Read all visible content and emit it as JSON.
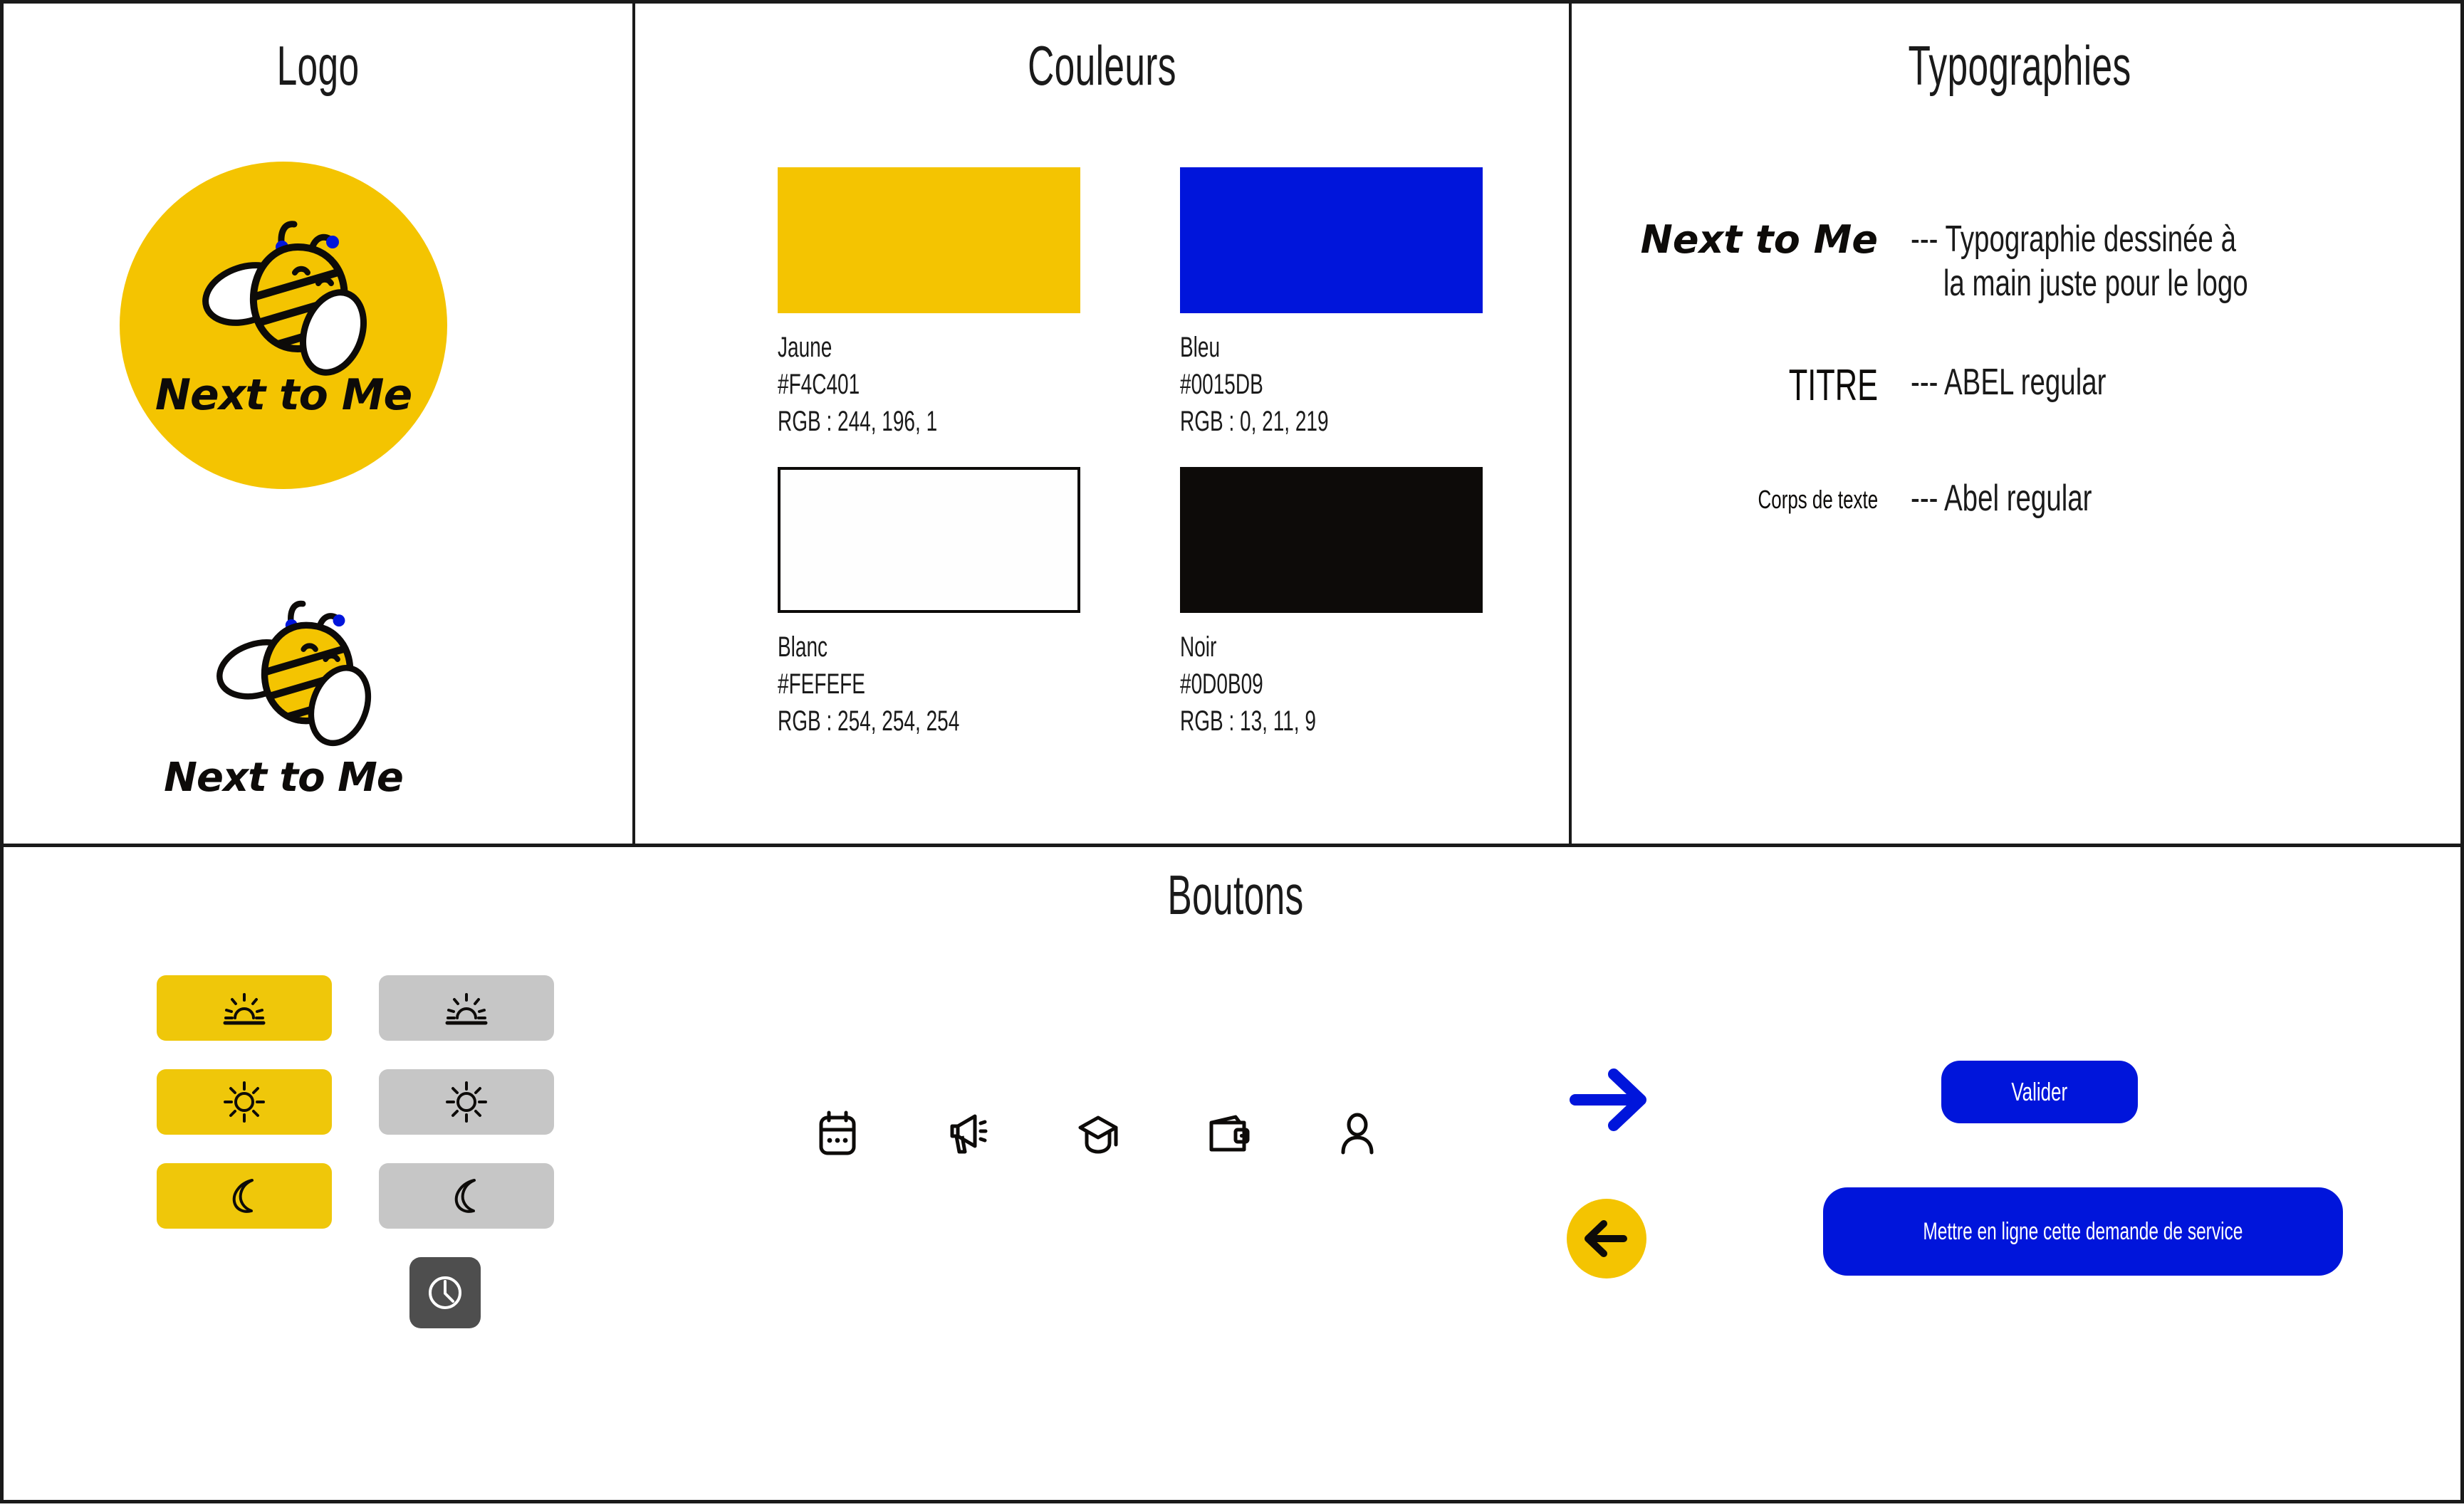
{
  "sections": {
    "logo": "Logo",
    "couleurs": "Couleurs",
    "typographies": "Typographies",
    "boutons": "Boutons"
  },
  "logo": {
    "wordmark": "Next to Me",
    "circle_color": "#F4C401",
    "bee_body_color": "#F4C401",
    "antenna_dot_color": "#0015DB",
    "outline_color": "#0d0b09"
  },
  "colors": [
    {
      "name": "Jaune",
      "hex": "#F4C401",
      "rgb": "RGB : 244, 196, 1",
      "swatch": "#F4C401",
      "bordered": false
    },
    {
      "name": "Bleu",
      "hex": "#0015DB",
      "rgb": "RGB : 0, 21, 219",
      "swatch": "#0015DB",
      "bordered": false
    },
    {
      "name": "Blanc",
      "hex": "#FEFEFE",
      "rgb": "RGB : 254, 254, 254",
      "swatch": "#FEFEFE",
      "bordered": true
    },
    {
      "name": "Noir",
      "hex": "#0D0B09",
      "rgb": "RGB : 13, 11, 9",
      "swatch": "#0D0B09",
      "bordered": false
    }
  ],
  "typography": [
    {
      "sample": "Next to Me",
      "note": "--- Typographie dessinée à",
      "note2": "la main juste pour le logo"
    },
    {
      "sample": "TITRE",
      "note": "--- ABEL regular",
      "note2": ""
    },
    {
      "sample": "Corps de texte",
      "note": "--- Abel regular",
      "note2": ""
    }
  ],
  "buttons": {
    "toggles": [
      {
        "icon": "sunrise-icon",
        "state_label": "actif",
        "color": "#EFC70A"
      },
      {
        "icon": "sunrise-icon",
        "state_label": "inactif",
        "color": "#C6C6C6"
      },
      {
        "icon": "sun-icon",
        "state_label": "actif",
        "color": "#EFC70A"
      },
      {
        "icon": "sun-icon",
        "state_label": "inactif",
        "color": "#C6C6C6"
      },
      {
        "icon": "moon-icon",
        "state_label": "actif",
        "color": "#EFC70A"
      },
      {
        "icon": "moon-icon",
        "state_label": "inactif",
        "color": "#C6C6C6"
      }
    ],
    "clock": {
      "icon": "clock-icon",
      "color": "#4E4E4E"
    },
    "nav_icons": [
      "calendar-icon",
      "megaphone-icon",
      "graduation-cap-icon",
      "wallet-icon",
      "user-icon"
    ],
    "arrow_forward": {
      "icon": "arrow-right-icon",
      "color": "#0015DB"
    },
    "arrow_back": {
      "icon": "arrow-left-icon",
      "circle_color": "#F4C401",
      "arrow_color": "#0d0b09"
    },
    "valider_label": "Valider",
    "mettre_en_ligne_label": "Mettre en ligne cette demande de service",
    "cta_color": "#0015DB",
    "cta_text_color": "#FFFFFF"
  }
}
